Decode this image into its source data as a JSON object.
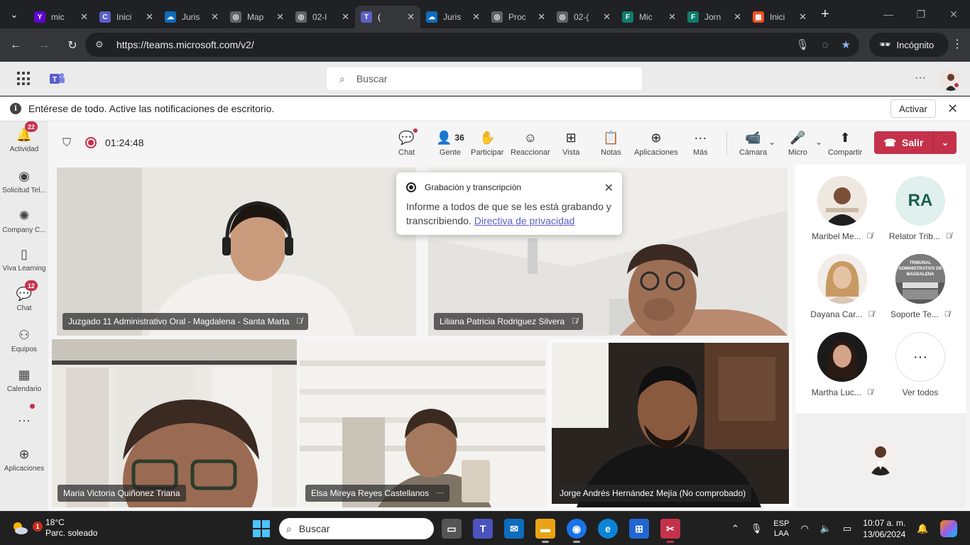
{
  "browser": {
    "tabs": [
      {
        "label": "mic",
        "fav": "Y",
        "color": "#6001d2"
      },
      {
        "label": "Inici",
        "fav": "C",
        "color": "#5b5fc7"
      },
      {
        "label": "Juris",
        "fav": "☁",
        "color": "#0f6cbd"
      },
      {
        "label": "Map",
        "fav": "◎",
        "color": "#5f6368"
      },
      {
        "label": "02-l",
        "fav": "◎",
        "color": "#5f6368"
      },
      {
        "label": "(",
        "fav": "T",
        "color": "#5b5fc7",
        "active": true
      },
      {
        "label": "Juris",
        "fav": "☁",
        "color": "#0f6cbd"
      },
      {
        "label": "Proc",
        "fav": "◎",
        "color": "#5f6368"
      },
      {
        "label": "02-(",
        "fav": "◎",
        "color": "#5f6368"
      },
      {
        "label": "Mic",
        "fav": "F",
        "color": "#0f7b6c"
      },
      {
        "label": "Jorn",
        "fav": "F",
        "color": "#0f7b6c"
      },
      {
        "label": "Inici",
        "fav": "▦",
        "color": "#f25022"
      }
    ],
    "url": "https://teams.microsoft.com/v2/",
    "incognito_label": "Incógnito"
  },
  "teams": {
    "search_placeholder": "Buscar",
    "notification": {
      "text": "Entérese de todo. Active las notificaciones de escritorio.",
      "action": "Activar"
    },
    "rail": [
      {
        "label": "Actividad",
        "badge": "22"
      },
      {
        "label": "Solicitud Tel..."
      },
      {
        "label": "Company C..."
      },
      {
        "label": "Viva Learning"
      },
      {
        "label": "Chat",
        "badge": "12"
      },
      {
        "label": "Equipos"
      },
      {
        "label": "Calendario"
      },
      {
        "label": "..."
      },
      {
        "label": "Aplicaciones"
      }
    ],
    "meeting": {
      "timer": "01:24:48",
      "buttons": {
        "chat": "Chat",
        "people": "Gente",
        "people_count": "36",
        "raise": "Participar",
        "react": "Reaccionar",
        "view": "Vista",
        "notes": "Notas",
        "apps": "Aplicaciones",
        "more": "Más",
        "camera": "Cámara",
        "mic": "Micro",
        "share": "Compartir",
        "leave": "Salir"
      },
      "tiles": [
        {
          "name": "Juzgado 11 Administrativo Oral - Magdalena - Santa Marta"
        },
        {
          "name": "Liliana Patricia Rodriguez Silvera"
        },
        {
          "name": "Maria Victoria Quiñonez Triana"
        },
        {
          "name": "Elsa Mireya Reyes Castellanos"
        },
        {
          "name": "Jorge Andrés Hernández Mejía (No comprobado)"
        }
      ],
      "popup": {
        "title": "Grabación y transcripción",
        "body": "Informe a todos de que se les está grabando y transcribiendo.",
        "link": "Directiva de privacidad"
      },
      "participants": [
        {
          "name": "Maribel Me..."
        },
        {
          "name": "Relator Trib...",
          "initials": "RA"
        },
        {
          "name": "Dayana Car..."
        },
        {
          "name": "Soporte Te...",
          "logo_text": "TRIBUNAL ADMINISTRATIVO DE MAGDALENA"
        },
        {
          "name": "Martha Luc..."
        },
        {
          "name": "Ver todos"
        }
      ]
    }
  },
  "taskbar": {
    "temp": "18°C",
    "weather": "Parc. soleado",
    "weather_badge": "1",
    "search": "Buscar",
    "lang1": "ESP",
    "lang2": "LAA",
    "time": "10:07 a. m.",
    "date": "13/06/2024"
  }
}
